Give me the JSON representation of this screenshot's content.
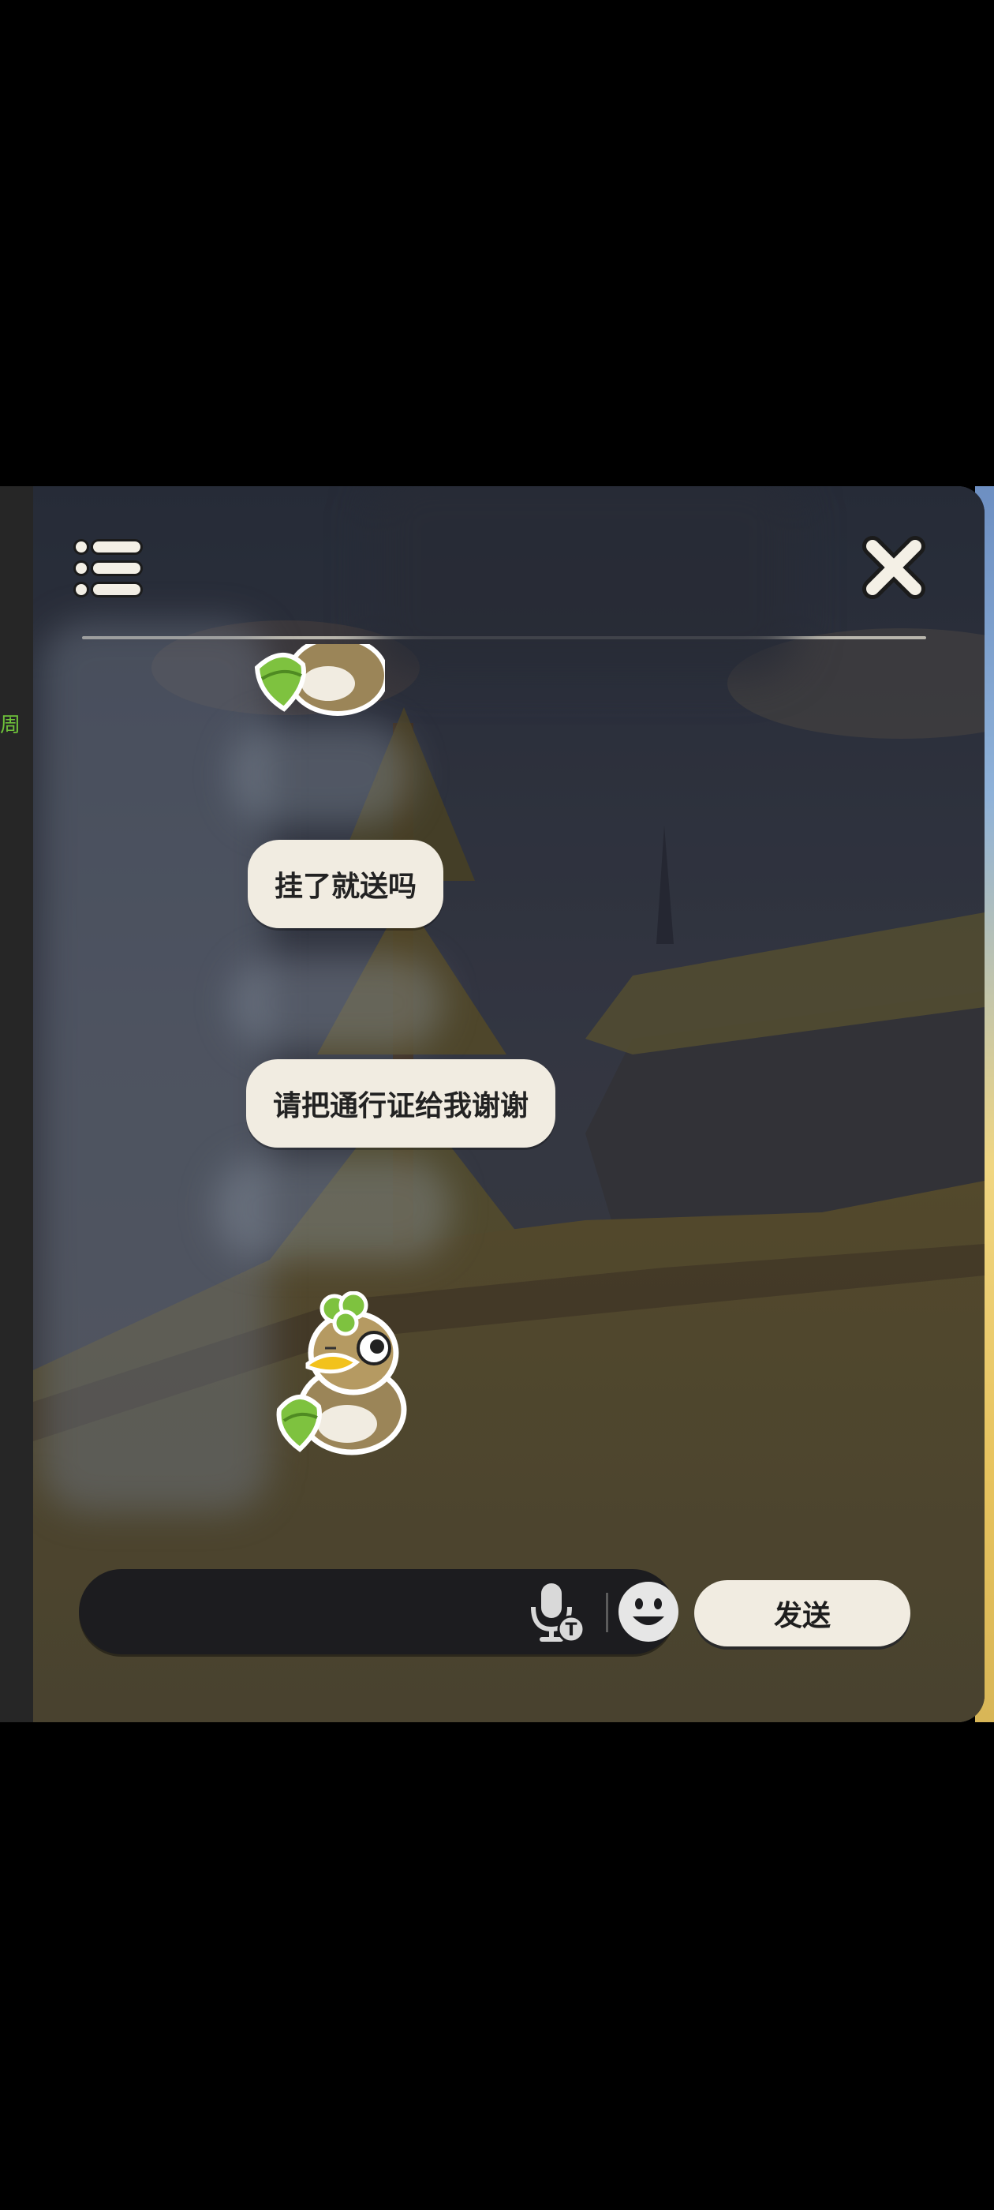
{
  "left_strip": {
    "edge_char": "周"
  },
  "messages": [
    {
      "type": "sticker",
      "name": "duck-hug-sticker"
    },
    {
      "type": "text",
      "text": "挂了就送吗"
    },
    {
      "type": "text",
      "text": "请把通行证给我谢谢"
    },
    {
      "type": "sticker",
      "name": "duck-hug-sticker"
    }
  ],
  "input": {
    "placeholder": "",
    "value": ""
  },
  "send_button": {
    "label": "发送"
  },
  "colors": {
    "bubble": "#f1ece1",
    "input_bar": "#1c1c1f",
    "accent_green": "#6ec23a"
  }
}
